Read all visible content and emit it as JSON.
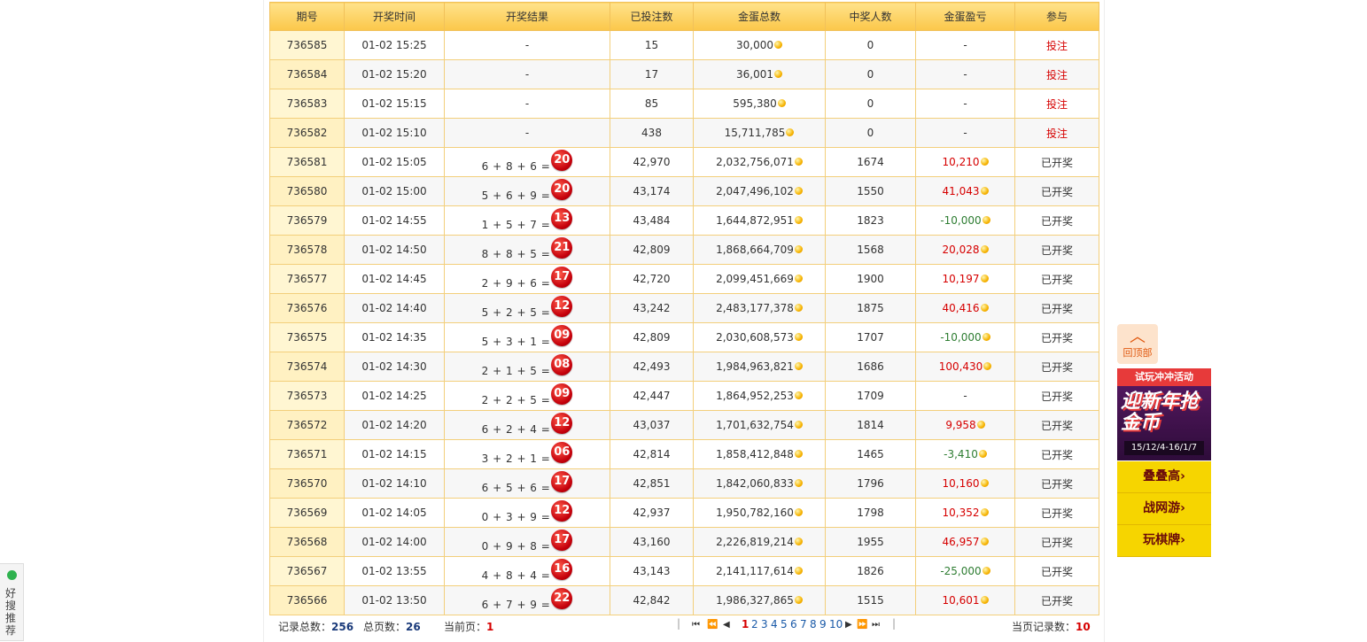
{
  "table": {
    "headers": [
      "期号",
      "开奖时间",
      "开奖结果",
      "已投注数",
      "金蛋总数",
      "中奖人数",
      "金蛋盈亏",
      "参与"
    ],
    "rows": [
      {
        "period": "736585",
        "time": "01-02 15:25",
        "expr": "-",
        "ball": "",
        "bets": "15",
        "eggs": "30,000",
        "winners": "0",
        "winners_color": "normal",
        "profit": "-",
        "profit_color": "normal",
        "action": "投注",
        "action_link": true
      },
      {
        "period": "736584",
        "time": "01-02 15:20",
        "expr": "-",
        "ball": "",
        "bets": "17",
        "eggs": "36,001",
        "winners": "0",
        "winners_color": "normal",
        "profit": "-",
        "profit_color": "normal",
        "action": "投注",
        "action_link": true
      },
      {
        "period": "736583",
        "time": "01-02 15:15",
        "expr": "-",
        "ball": "",
        "bets": "85",
        "eggs": "595,380",
        "winners": "0",
        "winners_color": "normal",
        "profit": "-",
        "profit_color": "normal",
        "action": "投注",
        "action_link": true
      },
      {
        "period": "736582",
        "time": "01-02 15:10",
        "expr": "-",
        "ball": "",
        "bets": "438",
        "eggs": "15,711,785",
        "winners": "0",
        "winners_color": "normal",
        "profit": "-",
        "profit_color": "normal",
        "action": "投注",
        "action_link": true
      },
      {
        "period": "736581",
        "time": "01-02 15:05",
        "expr": "6 + 8 + 6 =",
        "ball": "20",
        "bets": "42,970",
        "eggs": "2,032,756,071",
        "winners": "1674",
        "winners_color": "red",
        "profit": "10,210",
        "profit_color": "red",
        "action": "已开奖",
        "action_link": false
      },
      {
        "period": "736580",
        "time": "01-02 15:00",
        "expr": "5 + 6 + 9 =",
        "ball": "20",
        "bets": "43,174",
        "eggs": "2,047,496,102",
        "winners": "1550",
        "winners_color": "red",
        "profit": "41,043",
        "profit_color": "red",
        "action": "已开奖",
        "action_link": false
      },
      {
        "period": "736579",
        "time": "01-02 14:55",
        "expr": "1 + 5 + 7 =",
        "ball": "13",
        "bets": "43,484",
        "eggs": "1,644,872,951",
        "winners": "1823",
        "winners_color": "red",
        "profit": "-10,000",
        "profit_color": "green",
        "action": "已开奖",
        "action_link": false
      },
      {
        "period": "736578",
        "time": "01-02 14:50",
        "expr": "8 + 8 + 5 =",
        "ball": "21",
        "bets": "42,809",
        "eggs": "1,868,664,709",
        "winners": "1568",
        "winners_color": "red",
        "profit": "20,028",
        "profit_color": "red",
        "action": "已开奖",
        "action_link": false
      },
      {
        "period": "736577",
        "time": "01-02 14:45",
        "expr": "2 + 9 + 6 =",
        "ball": "17",
        "bets": "42,720",
        "eggs": "2,099,451,669",
        "winners": "1900",
        "winners_color": "red",
        "profit": "10,197",
        "profit_color": "red",
        "action": "已开奖",
        "action_link": false
      },
      {
        "period": "736576",
        "time": "01-02 14:40",
        "expr": "5 + 2 + 5 =",
        "ball": "12",
        "bets": "43,242",
        "eggs": "2,483,177,378",
        "winners": "1875",
        "winners_color": "red",
        "profit": "40,416",
        "profit_color": "red",
        "action": "已开奖",
        "action_link": false
      },
      {
        "period": "736575",
        "time": "01-02 14:35",
        "expr": "5 + 3 + 1 =",
        "ball": "09",
        "bets": "42,809",
        "eggs": "2,030,608,573",
        "winners": "1707",
        "winners_color": "red",
        "profit": "-10,000",
        "profit_color": "green",
        "action": "已开奖",
        "action_link": false
      },
      {
        "period": "736574",
        "time": "01-02 14:30",
        "expr": "2 + 1 + 5 =",
        "ball": "08",
        "bets": "42,493",
        "eggs": "1,984,963,821",
        "winners": "1686",
        "winners_color": "red",
        "profit": "100,430",
        "profit_color": "red",
        "action": "已开奖",
        "action_link": false
      },
      {
        "period": "736573",
        "time": "01-02 14:25",
        "expr": "2 + 2 + 5 =",
        "ball": "09",
        "bets": "42,447",
        "eggs": "1,864,952,253",
        "winners": "1709",
        "winners_color": "red",
        "profit": "-",
        "profit_color": "normal",
        "action": "已开奖",
        "action_link": false
      },
      {
        "period": "736572",
        "time": "01-02 14:20",
        "expr": "6 + 2 + 4 =",
        "ball": "12",
        "bets": "43,037",
        "eggs": "1,701,632,754",
        "winners": "1814",
        "winners_color": "red",
        "profit": "9,958",
        "profit_color": "red",
        "action": "已开奖",
        "action_link": false
      },
      {
        "period": "736571",
        "time": "01-02 14:15",
        "expr": "3 + 2 + 1 =",
        "ball": "06",
        "bets": "42,814",
        "eggs": "1,858,412,848",
        "winners": "1465",
        "winners_color": "red",
        "profit": "-3,410",
        "profit_color": "green",
        "action": "已开奖",
        "action_link": false
      },
      {
        "period": "736570",
        "time": "01-02 14:10",
        "expr": "6 + 5 + 6 =",
        "ball": "17",
        "bets": "42,851",
        "eggs": "1,842,060,833",
        "winners": "1796",
        "winners_color": "red",
        "profit": "10,160",
        "profit_color": "red",
        "action": "已开奖",
        "action_link": false
      },
      {
        "period": "736569",
        "time": "01-02 14:05",
        "expr": "0 + 3 + 9 =",
        "ball": "12",
        "bets": "42,937",
        "eggs": "1,950,782,160",
        "winners": "1798",
        "winners_color": "red",
        "profit": "10,352",
        "profit_color": "red",
        "action": "已开奖",
        "action_link": false
      },
      {
        "period": "736568",
        "time": "01-02 14:00",
        "expr": "0 + 9 + 8 =",
        "ball": "17",
        "bets": "43,160",
        "eggs": "2,226,819,214",
        "winners": "1955",
        "winners_color": "red",
        "profit": "46,957",
        "profit_color": "red",
        "action": "已开奖",
        "action_link": false
      },
      {
        "period": "736567",
        "time": "01-02 13:55",
        "expr": "4 + 8 + 4 =",
        "ball": "16",
        "bets": "43,143",
        "eggs": "2,141,117,614",
        "winners": "1826",
        "winners_color": "red",
        "profit": "-25,000",
        "profit_color": "green",
        "action": "已开奖",
        "action_link": false
      },
      {
        "period": "736566",
        "time": "01-02 13:50",
        "expr": "6 + 7 + 9 =",
        "ball": "22",
        "bets": "42,842",
        "eggs": "1,986,327,865",
        "winners": "1515",
        "winners_color": "red",
        "profit": "10,601",
        "profit_color": "red",
        "action": "已开奖",
        "action_link": false
      }
    ]
  },
  "footer": {
    "total_label": "记录总数：",
    "total_value": "256",
    "pages_label": "总页数：",
    "pages_value": "26",
    "current_label": "当前页：",
    "current_value": "1",
    "page_records_label": "当页记录数：",
    "page_records_value": "10",
    "separator": "|",
    "pages": [
      "1",
      "2",
      "3",
      "4",
      "5",
      "6",
      "7",
      "8",
      "9",
      "10"
    ],
    "nav_first": "⏮",
    "nav_prev_fast": "⏪",
    "nav_prev": "◀",
    "nav_next": "▶",
    "nav_next_fast": "⏩",
    "nav_last": "⏭"
  },
  "sidebar_right": {
    "to_top_label": "回顶部",
    "to_top_icon": "chevron-up-icon",
    "promo_title": "试玩冲冲活动",
    "promo_big": "迎新年抢金币",
    "promo_date": "15/12/4-16/1/7",
    "games": [
      "叠叠高",
      "战网游",
      "玩棋牌"
    ],
    "game_arrow": "›"
  },
  "sidebar_left": {
    "label": "好搜推荐"
  },
  "colors": {
    "header_bg": "#fbc74a",
    "red": "#d60000",
    "green": "#2e7d32",
    "ball": "#c4000b",
    "game_bg": "#f6d500"
  }
}
